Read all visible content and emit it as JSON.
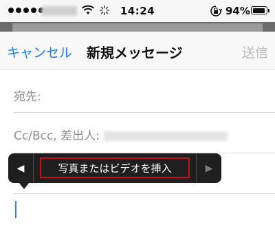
{
  "status_bar": {
    "time": "14:24",
    "battery_text": "94%",
    "battery_level": 0.94,
    "icons": [
      "signal-dots-icon",
      "wifi-icon",
      "activity-spinner-icon",
      "orientation-lock-icon",
      "battery-icon"
    ]
  },
  "navbar": {
    "cancel_label": "キャンセル",
    "title": "新規メッセージ",
    "send_label": "送信"
  },
  "fields": {
    "to_label": "宛先:",
    "cc_label": "Cc/Bcc, 差出人:"
  },
  "popup_menu": {
    "left_arrow": "◀",
    "item_label": "写真またはビデオを挿入",
    "right_arrow": "▶"
  },
  "colors": {
    "accent": "#1e7cf2",
    "disabled": "#b8b8b8",
    "highlight_border": "#c0141b",
    "menu_bg": "#1f1f1f"
  }
}
